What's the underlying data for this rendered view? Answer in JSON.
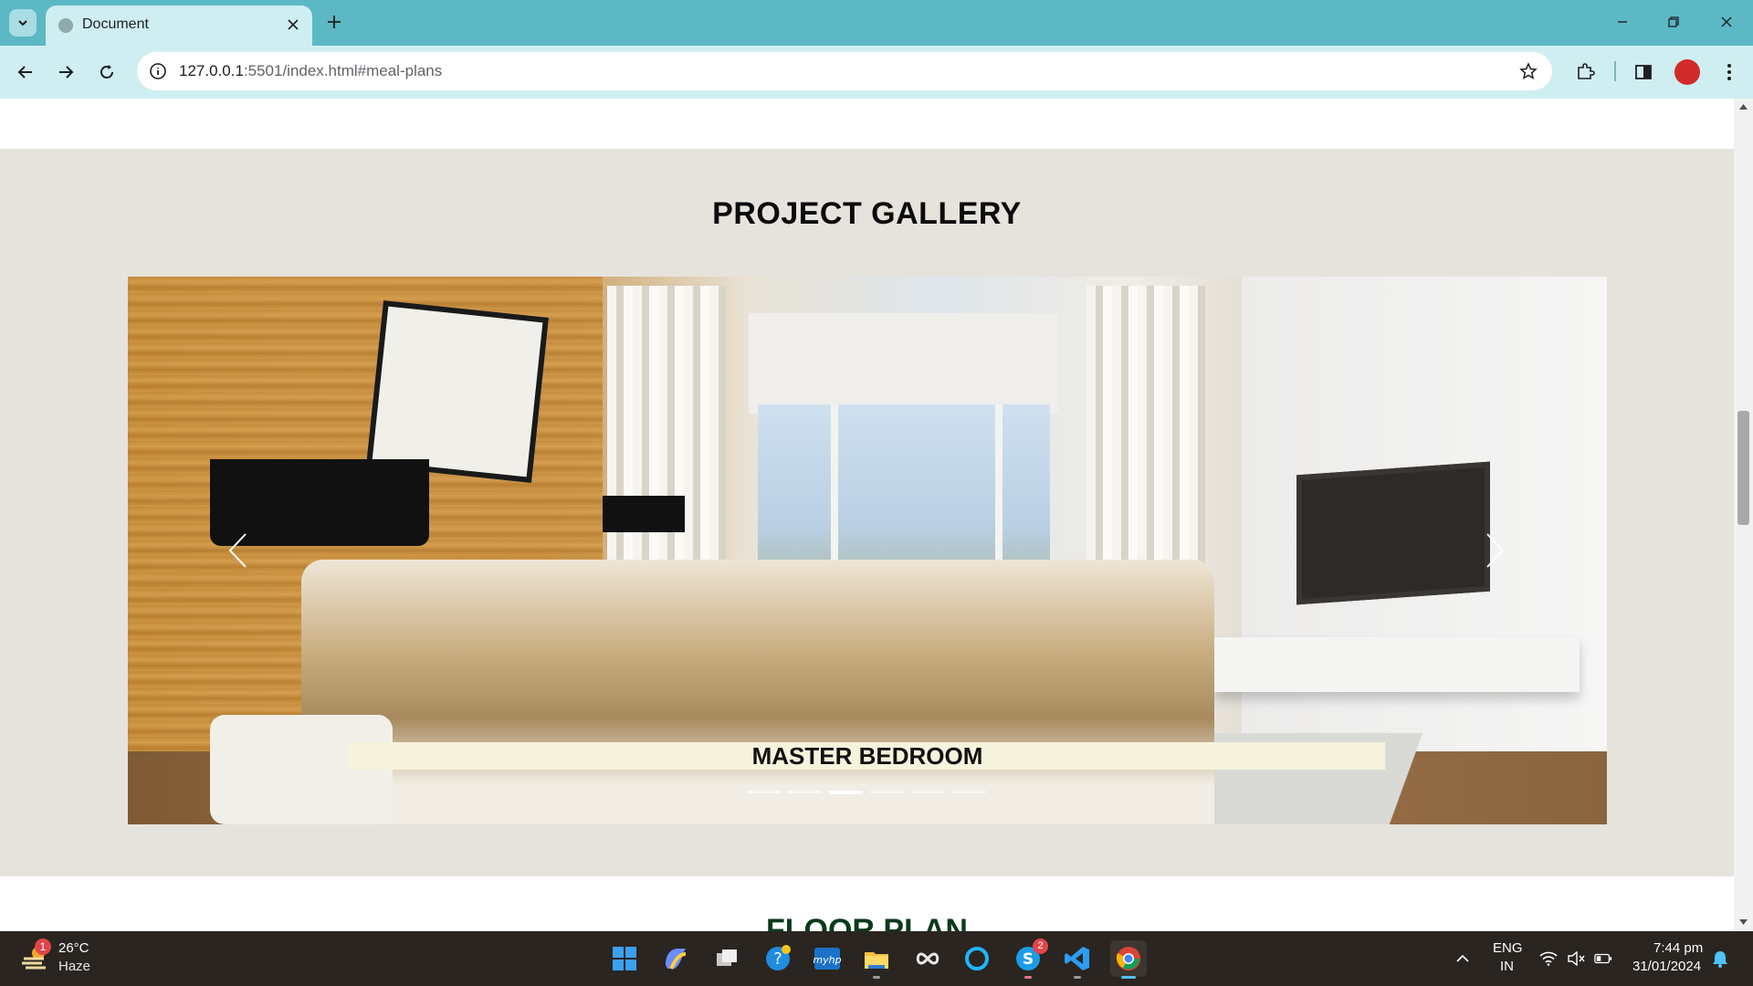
{
  "browser": {
    "tab_title": "Document",
    "url_host": "127.0.0.1",
    "url_path": ":5501/index.html#meal-plans"
  },
  "page": {
    "gallery_title": "PROJECT GALLERY",
    "slide_caption": "MASTER BEDROOM",
    "slide_count": 6,
    "active_slide_index": 2,
    "next_section_title": "FLOOR PLAN"
  },
  "taskbar": {
    "weather_temp": "26°C",
    "weather_condition": "Haze",
    "weather_badge": "1",
    "skype_badge": "2",
    "language_line1": "ENG",
    "language_line2": "IN",
    "time": "7:44 pm",
    "date": "31/01/2024"
  },
  "colors": {
    "tabbar_bg": "#5bb8c4",
    "toolbar_bg": "#cfeef1",
    "gallery_bg": "#e6e3dc",
    "caption_bg": "#f6f3dc",
    "taskbar_bg": "#2a2520"
  }
}
